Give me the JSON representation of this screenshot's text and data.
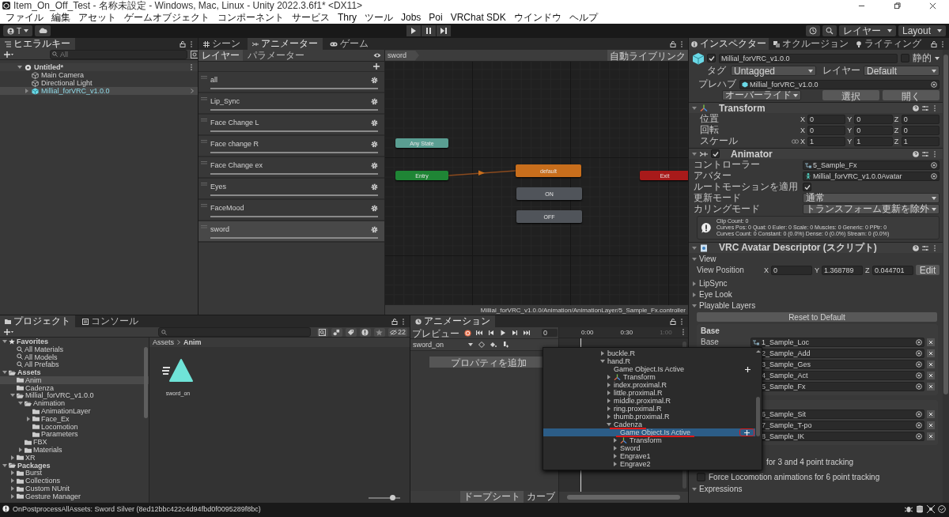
{
  "window": {
    "title": "Item_On_Off_Test - 名称未設定 - Windows, Mac, Linux - Unity 2022.3.6f1* <DX11>"
  },
  "menu": [
    "ファイル",
    "編集",
    "アセット",
    "ゲームオブジェクト",
    "コンポーネント",
    "サービス",
    "Thry",
    "ツール",
    "Jobs",
    "Poi",
    "VRChat SDK",
    "ウインドウ",
    "ヘルプ"
  ],
  "toolbar": {
    "account": "T",
    "layers": "レイヤー",
    "layout": "Layout"
  },
  "hierarchy": {
    "tab": "ヒエラルキー",
    "search_placeholder": "All",
    "scene": "Untitled*",
    "items": [
      {
        "name": "Main Camera",
        "kind": "object",
        "selected": false
      },
      {
        "name": "Directional Light",
        "kind": "object",
        "selected": false
      },
      {
        "name": "Millial_forVRC_v1.0.0",
        "kind": "prefab",
        "selected": true
      }
    ]
  },
  "animator": {
    "tabs": [
      {
        "label": "シーン",
        "selected": false
      },
      {
        "label": "アニメーター",
        "selected": true
      },
      {
        "label": "ゲーム",
        "selected": false
      }
    ],
    "subtabs": [
      {
        "label": "レイヤー",
        "selected": true
      },
      {
        "label": "パラメーター",
        "selected": false
      }
    ],
    "layers": [
      {
        "name": "all",
        "selected": false
      },
      {
        "name": "Lip_Sync",
        "selected": false
      },
      {
        "name": "Face Change L",
        "selected": false
      },
      {
        "name": "Face change R",
        "selected": false
      },
      {
        "name": "Face Change ex",
        "selected": false
      },
      {
        "name": "Eyes",
        "selected": false
      },
      {
        "name": "FaceMood",
        "selected": false
      },
      {
        "name": "sword",
        "selected": true
      }
    ],
    "breadcrumb": "sword",
    "live_link": "自動ライブリンク",
    "nodes": [
      {
        "label": "Any State",
        "kind": "any"
      },
      {
        "label": "Entry",
        "kind": "entry"
      },
      {
        "label": "default",
        "kind": "default"
      },
      {
        "label": "ON",
        "kind": "state"
      },
      {
        "label": "OFF",
        "kind": "state"
      },
      {
        "label": "Exit",
        "kind": "exit"
      }
    ],
    "path": "Millial_forVRC_v1.0.0/Animation/AnimationLayer/5_Sample_Fx.controller"
  },
  "inspector": {
    "tabs": [
      {
        "label": "インスペクター",
        "selected": true
      },
      {
        "label": "オクルージョン",
        "selected": false
      },
      {
        "label": "ライティング",
        "selected": false
      }
    ],
    "object": {
      "active": true,
      "name": "Millial_forVRC_v1.0.0",
      "static_label": "静的",
      "static": false,
      "tag_label": "タグ",
      "tag": "Untagged",
      "layer_label": "レイヤー",
      "layer": "Default",
      "prefab_label": "プレハブ",
      "prefab": "Millial_forVRC_v1.0.0",
      "overrides": "オーバーライド",
      "buttons": [
        "選択",
        "開く"
      ]
    },
    "transform": {
      "title": "Transform",
      "expanded": true,
      "rows": [
        {
          "label": "位置",
          "values": [
            {
              "axis": "X",
              "value": "0"
            },
            {
              "axis": "Y",
              "value": "0"
            },
            {
              "axis": "Z",
              "value": "0"
            }
          ]
        },
        {
          "label": "回転",
          "values": [
            {
              "axis": "X",
              "value": "0"
            },
            {
              "axis": "Y",
              "value": "0"
            },
            {
              "axis": "Z",
              "value": "0"
            }
          ]
        },
        {
          "label": "スケール",
          "values": [
            {
              "axis": "X",
              "value": "1"
            },
            {
              "axis": "Y",
              "value": "1"
            },
            {
              "axis": "Z",
              "value": "1"
            }
          ]
        }
      ]
    },
    "animator": {
      "title": "Animator",
      "enabled": true,
      "expanded": true,
      "fields": [
        {
          "label": "コントローラー",
          "kind": "controller",
          "value": "5_Sample_Fx"
        },
        {
          "label": "アバター",
          "kind": "avatar",
          "value": "Millial_forVRC_v1.0.0Avatar"
        },
        {
          "label": "ルートモーションを適用",
          "kind": "checkbox",
          "checked": true
        },
        {
          "label": "更新モード",
          "kind": "dropdown",
          "value": "通常"
        },
        {
          "label": "カリングモード",
          "kind": "dropdown",
          "value": "トランスフォーム更新を除外"
        }
      ],
      "info": [
        "Clip Count: 0",
        "Curves Pos: 0 Quat: 0 Euler: 0 Scale: 0 Muscles: 0 Generic: 0 PPtr: 0",
        "Curves Count: 0 Constant: 0 (0.0%) Dense: 0 (0.0%) Stream: 0 (0.0%)"
      ]
    },
    "descriptor": {
      "title": "VRC Avatar Descriptor (スクリプト)",
      "expanded": true,
      "view": {
        "label": "View",
        "expanded": true
      },
      "view_position": {
        "label": "View Position",
        "values": [
          {
            "axis": "X",
            "value": "0"
          },
          {
            "axis": "Y",
            "value": "1.368789"
          },
          {
            "axis": "Z",
            "value": "0.044701"
          }
        ],
        "button": "Edit"
      },
      "sections": [
        {
          "label": "LipSync",
          "expanded": false
        },
        {
          "label": "Eye Look",
          "expanded": false
        },
        {
          "label": "Playable Layers",
          "expanded": true
        }
      ],
      "reset": "Reset to Default",
      "base": {
        "title": "Base",
        "layers": [
          {
            "label": "Base",
            "value": "1_Sample_Loc"
          },
          {
            "value": "2_Sample_Add"
          },
          {
            "value": "3_Sample_Ges"
          },
          {
            "value": "4_Sample_Act"
          },
          {
            "value": "5_Sample_Fx"
          }
        ]
      },
      "special": {
        "layers": [
          {
            "value": "6_Sample_Sit"
          },
          {
            "value": "7_Sample_T-po"
          },
          {
            "value": "8_Sample_IK"
          }
        ]
      },
      "tracking_note": "for 3 and 4 point tracking",
      "force_locomotion": {
        "label": "Force Locomotion animations for 6 point tracking",
        "checked": false
      },
      "expressions": {
        "label": "Expressions",
        "expanded": true
      }
    }
  },
  "project": {
    "tabs": [
      {
        "label": "プロジェクト",
        "selected": true
      },
      {
        "label": "コンソール",
        "selected": false
      }
    ],
    "hidden_count": "22",
    "tree": [
      {
        "label": "Favorites",
        "kind": "favorites",
        "expanded": true,
        "selected": false,
        "children": [
          {
            "label": "All Materials",
            "kind": "search",
            "selected": false
          },
          {
            "label": "All Models",
            "kind": "search",
            "selected": false
          },
          {
            "label": "All Prefabs",
            "kind": "search",
            "selected": false
          }
        ]
      },
      {
        "label": "Assets",
        "kind": "root",
        "expanded": true,
        "selected": false,
        "children": [
          {
            "label": "Anim",
            "kind": "folder",
            "selected": true
          },
          {
            "label": "Cadenza",
            "kind": "folder",
            "selected": false
          },
          {
            "label": "Millial_forVRC_v1.0.0",
            "kind": "folder",
            "expanded": true,
            "selected": false,
            "children": [
              {
                "label": "Animation",
                "kind": "folder",
                "expanded": true,
                "selected": false,
                "children": [
                  {
                    "label": "AnimationLayer",
                    "kind": "folder",
                    "selected": false
                  },
                  {
                    "label": "Face_Ex",
                    "kind": "folder",
                    "expanded": false,
                    "selected": false
                  },
                  {
                    "label": "Locomotion",
                    "kind": "folder",
                    "selected": false
                  },
                  {
                    "label": "Parameters",
                    "kind": "folder",
                    "selected": false
                  }
                ]
              },
              {
                "label": "FBX",
                "kind": "folder",
                "selected": false
              },
              {
                "label": "Materials",
                "kind": "folder",
                "expanded": false,
                "selected": false
              }
            ]
          },
          {
            "label": "XR",
            "kind": "folder",
            "expanded": false,
            "selected": false
          }
        ]
      },
      {
        "label": "Packages",
        "kind": "root",
        "expanded": true,
        "selected": false,
        "children": [
          {
            "label": "Burst",
            "kind": "folder",
            "expanded": false,
            "selected": false
          },
          {
            "label": "Collections",
            "kind": "folder",
            "expanded": false,
            "selected": false
          },
          {
            "label": "Custom NUnit",
            "kind": "folder",
            "expanded": false,
            "selected": false
          },
          {
            "label": "Gesture Manager",
            "kind": "folder",
            "expanded": false,
            "selected": false
          }
        ]
      }
    ],
    "breadcrumb": [
      "Assets",
      "Anim"
    ],
    "assets": [
      {
        "name": "sword_on",
        "kind": "animation"
      }
    ],
    "zoom": {
      "level": 0.75
    }
  },
  "animation": {
    "tab": "アニメーション",
    "preview": "プレビュー",
    "frame": "0",
    "clip": "sword_on",
    "add_property": "プロパティを追加",
    "ruler": [
      "0:00",
      "0:30",
      "1:00"
    ],
    "bottom_tabs": [
      {
        "label": "ドープシート",
        "selected": true
      },
      {
        "label": "カーブ",
        "selected": false
      }
    ]
  },
  "property_popup": {
    "items": [
      {
        "label": "buckle.R",
        "kind": "object",
        "expanded": false,
        "selected": false,
        "marked": false
      },
      {
        "label": "hand.R",
        "kind": "object",
        "expanded": true,
        "selected": false,
        "marked": false,
        "children": [
          {
            "label": "Game Object.Is Active",
            "kind": "property",
            "selected": false,
            "marked": false,
            "add_highlighted": false
          },
          {
            "label": "Transform",
            "kind": "transform",
            "expanded": false,
            "selected": false,
            "marked": false
          },
          {
            "label": "index.proximal.R",
            "kind": "object",
            "expanded": false,
            "selected": false,
            "marked": false
          },
          {
            "label": "little.proximal.R",
            "kind": "object",
            "expanded": false,
            "selected": false,
            "marked": false
          },
          {
            "label": "middle.proximal.R",
            "kind": "object",
            "expanded": false,
            "selected": false,
            "marked": false
          },
          {
            "label": "ring.proximal.R",
            "kind": "object",
            "expanded": false,
            "selected": false,
            "marked": false
          },
          {
            "label": "thumb.proximal.R",
            "kind": "object",
            "expanded": false,
            "selected": false,
            "marked": false
          },
          {
            "label": "Cadenza",
            "kind": "object",
            "expanded": true,
            "selected": false,
            "marked": true,
            "children": [
              {
                "label": "Game Object.Is Active",
                "kind": "property",
                "selected": true,
                "marked": true,
                "add_highlighted": true
              },
              {
                "label": "Transform",
                "kind": "transform",
                "expanded": false,
                "selected": false,
                "marked": false
              },
              {
                "label": "Sword",
                "kind": "object",
                "expanded": false,
                "selected": false,
                "marked": false
              },
              {
                "label": "Engrave1",
                "kind": "object",
                "expanded": false,
                "selected": false,
                "marked": false
              },
              {
                "label": "Engrave2",
                "kind": "object",
                "expanded": false,
                "selected": false,
                "marked": false
              }
            ]
          }
        ]
      }
    ]
  },
  "status": {
    "message": "OnPostprocessAllAssets: Sword Silver (8ed12bbc422c4d94fbd0f0095289f8bc)"
  }
}
